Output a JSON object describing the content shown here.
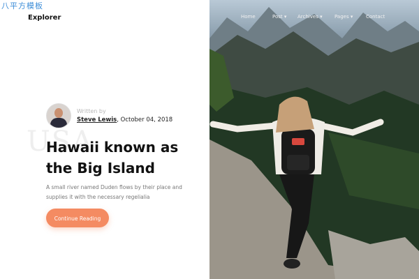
{
  "watermark": "八平方模板",
  "brand": "Explorer",
  "ghost_text": "USA",
  "nav": {
    "items": [
      {
        "label": "Home"
      },
      {
        "label": "Post ▾"
      },
      {
        "label": "Archives ▾"
      },
      {
        "label": "Pages ▾"
      },
      {
        "label": "Contact"
      }
    ]
  },
  "author": {
    "written_by": "Written by",
    "name": "Steve Lewis",
    "date": ", October 04, 2018"
  },
  "post": {
    "title": "Hawaii known as the Big Island",
    "excerpt": "A small river named Duden flows by their place and supplies it with the necessary regelialia",
    "cta_label": "Continue Reading"
  },
  "colors": {
    "accent": "#f48b62",
    "title": "#111111",
    "muted": "#777777",
    "watermark": "#3e8ed8"
  },
  "icons": {
    "avatar": "author-avatar"
  }
}
